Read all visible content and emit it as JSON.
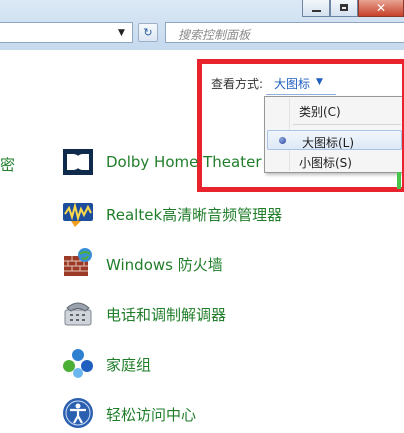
{
  "search": {
    "placeholder": "搜索控制面板"
  },
  "view_by": {
    "label": "查看方式:",
    "value": "大图标",
    "options": [
      {
        "label": "类别(C)",
        "selected": false
      },
      {
        "label": "大图标(L)",
        "selected": true
      },
      {
        "label": "小图标(S)",
        "selected": false
      }
    ]
  },
  "partial_left_text": "密",
  "items": [
    {
      "label": "Dolby Home Theater",
      "icon": "dolby-icon"
    },
    {
      "label": "Realtek高清晰音频管理器",
      "icon": "realtek-audio-icon"
    },
    {
      "label": "Windows 防火墙",
      "icon": "firewall-icon"
    },
    {
      "label": "电话和调制解调器",
      "icon": "phone-modem-icon"
    },
    {
      "label": "家庭组",
      "icon": "homegroup-icon"
    },
    {
      "label": "轻松访问中心",
      "icon": "ease-of-access-icon"
    }
  ],
  "colors": {
    "link_green": "#207e2a",
    "highlight_red": "#e8232d",
    "view_link_blue": "#1f5fbf"
  }
}
